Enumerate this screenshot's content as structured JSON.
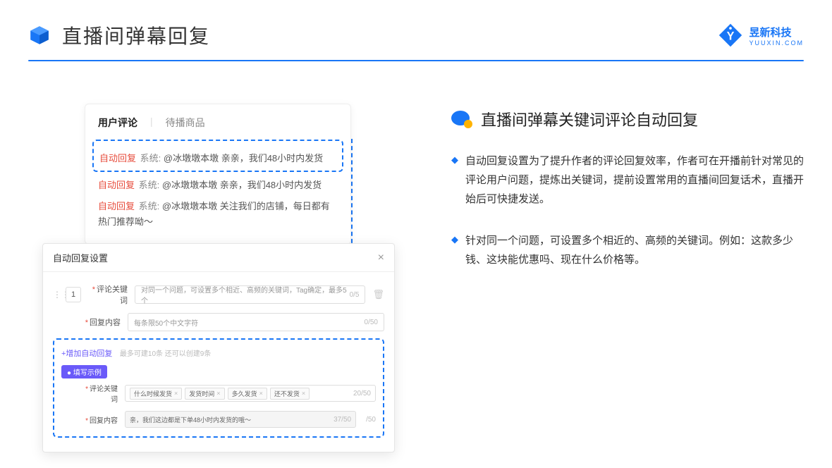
{
  "header": {
    "title": "直播间弹幕回复",
    "brand_name": "昱新科技",
    "brand_url": "YUUXIN.COM"
  },
  "comments": {
    "tab_active": "用户评论",
    "tab_other": "待播商品",
    "row1_tag": "自动回复",
    "row1_sys": "系统:",
    "row1_text": "@冰墩墩本墩 亲亲，我们48小时内发货",
    "row2_tag": "自动回复",
    "row2_sys": "系统:",
    "row2_text": "@冰墩墩本墩 亲亲，我们48小时内发货",
    "row3_tag": "自动回复",
    "row3_sys": "系统:",
    "row3_text": "@冰墩墩本墩 关注我们的店铺，每日都有热门推荐呦～"
  },
  "settings": {
    "title": "自动回复设置",
    "order": "1",
    "kw_label": "评论关键词",
    "kw_placeholder": "对同一个问题，可设置多个相近、高频的关键词，Tag确定，最多5个",
    "kw_counter": "0/5",
    "reply_label": "回复内容",
    "reply_placeholder": "每条限50个中文字符",
    "reply_counter": "0/50",
    "add_text": "+增加自动回复",
    "add_hint": "最多可建10条 还可以创建9条",
    "demo_badge": "● 填写示例",
    "demo_kw_label": "评论关键词",
    "demo_kw_counter": "20/50",
    "demo_reply_label": "回复内容",
    "demo_reply_text": "亲，我们这边都是下单48小时内发货的哦～",
    "demo_reply_counter": "37/50",
    "spare_counter": "/50",
    "tags": [
      "什么时候发货",
      "发货时间",
      "多久发货",
      "还不发货"
    ]
  },
  "right": {
    "title": "直播间弹幕关键词评论自动回复",
    "p1": "自动回复设置为了提升作者的评论回复效率，作者可在开播前针对常见的评论用户问题，提炼出关键词，提前设置常用的直播间回复话术，直播开始后可快捷发送。",
    "p2": "针对同一个问题，可设置多个相近的、高频的关键词。例如：这款多少钱、这块能优惠吗、现在什么价格等。"
  }
}
